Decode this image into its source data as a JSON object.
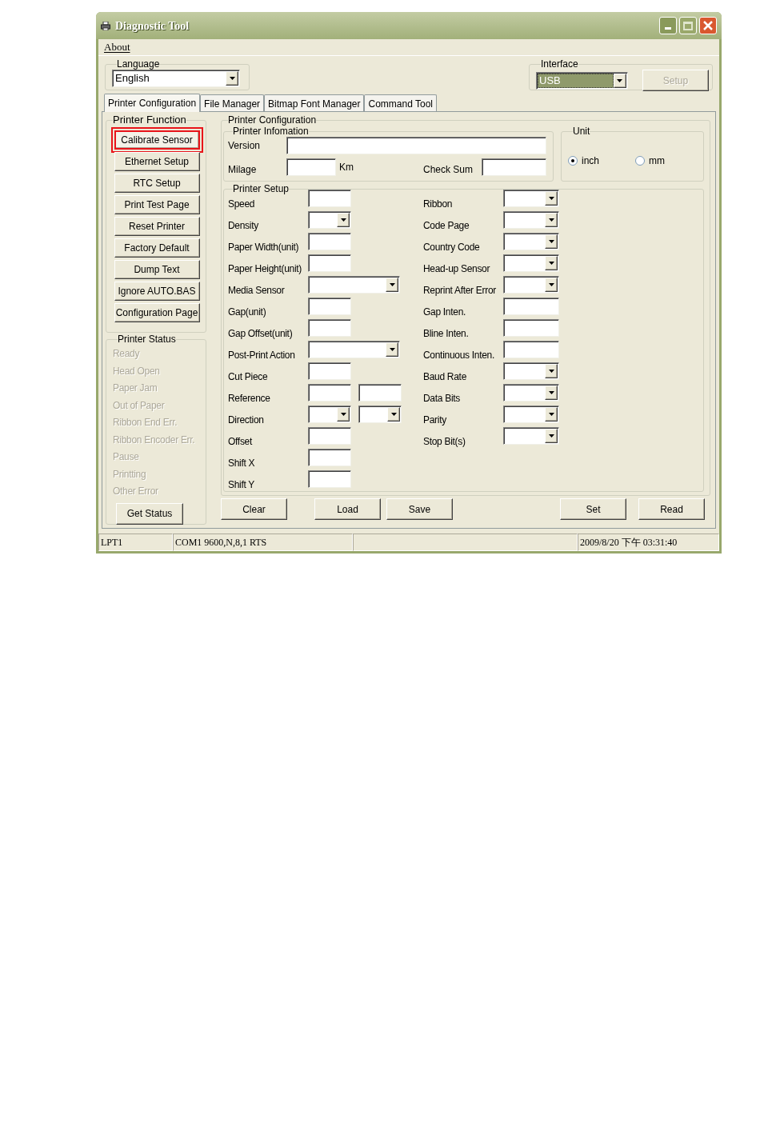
{
  "window": {
    "title": "Diagnostic Tool"
  },
  "menu": [
    {
      "label": "About"
    }
  ],
  "language": {
    "label": "Language",
    "value": "English"
  },
  "interface": {
    "label": "Interface",
    "value": "USB",
    "focused": true,
    "button": {
      "label": "Setup",
      "disabled": true
    }
  },
  "tabs": [
    {
      "label": "Printer Configuration",
      "selected": true
    },
    {
      "label": "File Manager",
      "selected": false
    },
    {
      "label": "Bitmap Font Manager",
      "selected": false
    },
    {
      "label": "Command Tool",
      "selected": false
    }
  ],
  "printer_function": {
    "title": "Printer Function",
    "buttons": [
      {
        "label": "Calibrate Sensor",
        "highlighted": true
      },
      {
        "label": "Ethernet Setup",
        "highlighted": false
      },
      {
        "label": "RTC Setup",
        "highlighted": false
      },
      {
        "label": "Print Test Page",
        "highlighted": false
      },
      {
        "label": "Reset Printer",
        "highlighted": false
      },
      {
        "label": "Factory Default",
        "highlighted": false
      },
      {
        "label": "Dump Text",
        "highlighted": false
      },
      {
        "label": "Ignore AUTO.BAS",
        "highlighted": false
      },
      {
        "label": "Configuration Page",
        "highlighted": false
      }
    ]
  },
  "printer_status": {
    "title": "Printer Status",
    "items": [
      {
        "label": "Ready",
        "disabled": true
      },
      {
        "label": "Head Open",
        "disabled": true
      },
      {
        "label": "Paper Jam",
        "disabled": true
      },
      {
        "label": "Out of Paper",
        "disabled": true
      },
      {
        "label": "Ribbon End Err.",
        "disabled": true
      },
      {
        "label": "Ribbon Encoder Err.",
        "disabled": true
      },
      {
        "label": "Pause",
        "disabled": true
      },
      {
        "label": "Printting",
        "disabled": true
      },
      {
        "label": "Other Error",
        "disabled": true
      }
    ],
    "button": "Get Status"
  },
  "printer_configuration": {
    "title": "Printer Configuration",
    "printer_information": {
      "title": "Printer Infomation",
      "version_label": "Version",
      "milage_label": "Milage",
      "milage_unit": "Km",
      "check_sum_label": "Check Sum"
    },
    "unit": {
      "title": "Unit",
      "options": [
        {
          "label": "inch",
          "selected": true
        },
        {
          "label": "mm",
          "selected": false
        }
      ]
    },
    "printer_setup": {
      "title": "Printer Setup",
      "left": [
        {
          "label": "Speed",
          "kind": "text"
        },
        {
          "label": "Density",
          "kind": "dropdown"
        },
        {
          "label": "Paper Width(unit)",
          "kind": "text"
        },
        {
          "label": "Paper Height(unit)",
          "kind": "text"
        },
        {
          "label": "Media Sensor",
          "kind": "wide_dropdown"
        },
        {
          "label": "Gap(unit)",
          "kind": "text"
        },
        {
          "label": "Gap Offset(unit)",
          "kind": "text"
        },
        {
          "label": "Post-Print Action",
          "kind": "wide_dropdown"
        },
        {
          "label": "Cut Piece",
          "kind": "text"
        },
        {
          "label": "Reference",
          "kind": "text_pair"
        },
        {
          "label": "Direction",
          "kind": "dropdown_pair"
        },
        {
          "label": "Offset",
          "kind": "text"
        },
        {
          "label": "Shift X",
          "kind": "text"
        },
        {
          "label": "Shift Y",
          "kind": "text"
        }
      ],
      "right": [
        {
          "label": "Ribbon",
          "kind": "dropdown"
        },
        {
          "label": "Code Page",
          "kind": "dropdown"
        },
        {
          "label": "Country Code",
          "kind": "dropdown"
        },
        {
          "label": "Head-up Sensor",
          "kind": "dropdown"
        },
        {
          "label": "Reprint After Error",
          "kind": "dropdown"
        },
        {
          "label": "Gap Inten.",
          "kind": "text"
        },
        {
          "label": "Bline Inten.",
          "kind": "text"
        },
        {
          "label": "Continuous Inten.",
          "kind": "text"
        },
        {
          "label": "Baud Rate",
          "kind": "dropdown"
        },
        {
          "label": "Data Bits",
          "kind": "dropdown"
        },
        {
          "label": "Parity",
          "kind": "dropdown"
        },
        {
          "label": "Stop Bit(s)",
          "kind": "dropdown"
        }
      ]
    },
    "buttons": [
      "Clear",
      "Load",
      "Save",
      "Set",
      "Read"
    ]
  },
  "status_bar": [
    {
      "kind": "text",
      "text": "LPT1"
    },
    {
      "kind": "text",
      "text": "COM1 9600,N,8,1 RTS"
    },
    {
      "kind": "blank"
    },
    {
      "kind": "text",
      "text": "2009/8/20 下午 03:31:40"
    }
  ]
}
